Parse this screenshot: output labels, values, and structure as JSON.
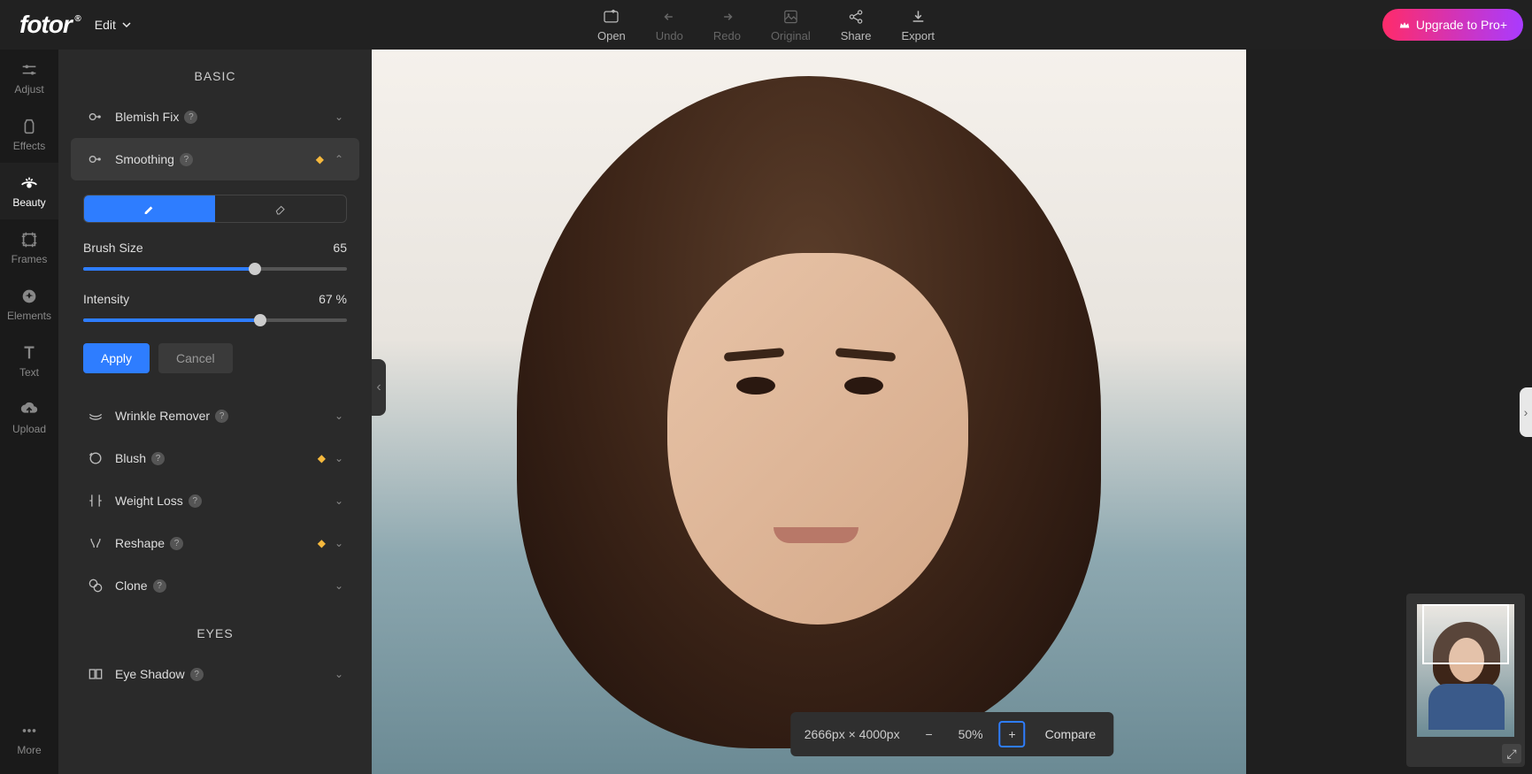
{
  "header": {
    "logo": "fotor",
    "edit": "Edit",
    "open": "Open",
    "undo": "Undo",
    "redo": "Redo",
    "original": "Original",
    "share": "Share",
    "export": "Export",
    "upgrade": "Upgrade to Pro+"
  },
  "nav": {
    "adjust": "Adjust",
    "effects": "Effects",
    "beauty": "Beauty",
    "frames": "Frames",
    "elements": "Elements",
    "text": "Text",
    "upload": "Upload",
    "more": "More"
  },
  "panel": {
    "section_basic": "BASIC",
    "section_eyes": "EYES",
    "blemish_fix": "Blemish Fix",
    "smoothing": "Smoothing",
    "wrinkle_remover": "Wrinkle Remover",
    "blush": "Blush",
    "weight_loss": "Weight Loss",
    "reshape": "Reshape",
    "clone": "Clone",
    "eye_shadow": "Eye Shadow",
    "brush_size_label": "Brush Size",
    "brush_size_value": "65",
    "intensity_label": "Intensity",
    "intensity_value": "67",
    "intensity_unit": " %",
    "apply": "Apply",
    "cancel": "Cancel"
  },
  "status": {
    "dimensions": "2666px × 4000px",
    "zoom": "50%",
    "compare": "Compare"
  }
}
